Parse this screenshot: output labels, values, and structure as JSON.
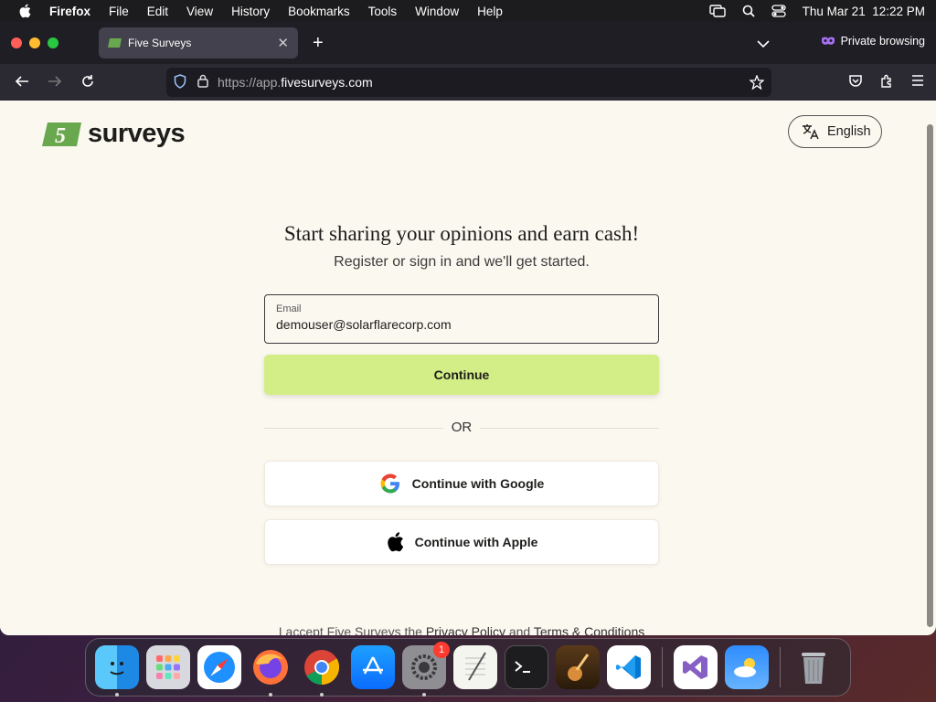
{
  "menubar": {
    "app_name": "Firefox",
    "items": [
      "File",
      "Edit",
      "View",
      "History",
      "Bookmarks",
      "Tools",
      "Window",
      "Help"
    ],
    "datetime": "Thu Mar 21  12:22 PM"
  },
  "browser": {
    "tab_title": "Five Surveys",
    "private_label": "Private browsing",
    "url_prefix": "https://app.",
    "url_domain": "fivesurveys.com"
  },
  "page": {
    "logo_number": "5",
    "logo_word": "surveys",
    "language_label": "English",
    "headline": "Start sharing your opinions and earn cash!",
    "subline": "Register or sign in and we'll get started.",
    "email_label": "Email",
    "email_value": "demouser@solarflarecorp.com",
    "continue_label": "Continue",
    "or_label": "OR",
    "google_label": "Continue with Google",
    "apple_label": "Continue with Apple",
    "footer_prefix": "I accept Five Surveys the",
    "footer_privacy": "Privacy Policy",
    "footer_and": "and",
    "footer_terms": "Terms & Conditions"
  },
  "dock": {
    "apps": [
      "finder-icon",
      "launchpad-icon",
      "safari-icon",
      "firefox-icon",
      "chrome-icon",
      "app-store-icon",
      "system-settings-icon",
      "textedit-icon",
      "terminal-icon",
      "garageband-icon",
      "vscode-icon",
      "visual-studio-icon",
      "weather-icon",
      "trash-icon"
    ],
    "settings_badge": "1"
  },
  "colors": {
    "accent_green": "#d3ee86",
    "logo_green": "#5a9a2a",
    "page_bg": "#fbf8f0"
  }
}
